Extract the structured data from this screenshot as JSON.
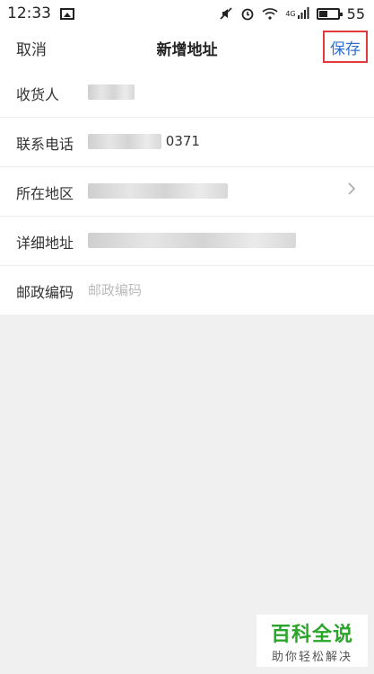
{
  "status_bar": {
    "time": "12:33",
    "network_type": "4G",
    "battery": "55",
    "battery_level_percent": 55
  },
  "nav": {
    "cancel_label": "取消",
    "title": "新增地址",
    "save_label": "保存"
  },
  "form": {
    "rows": [
      {
        "label": "收货人",
        "value": ""
      },
      {
        "label": "联系电话",
        "value": "0371"
      },
      {
        "label": "所在地区",
        "value": ""
      },
      {
        "label": "详细地址",
        "value": ""
      },
      {
        "label": "邮政编码",
        "placeholder": "邮政编码"
      }
    ]
  },
  "watermark": {
    "title": "百科全说",
    "subtitle": "助你轻松解决"
  },
  "colors": {
    "save_text": "#2f6fd0",
    "highlight_border": "#e03a3a",
    "watermark_green": "#2aa52a"
  }
}
